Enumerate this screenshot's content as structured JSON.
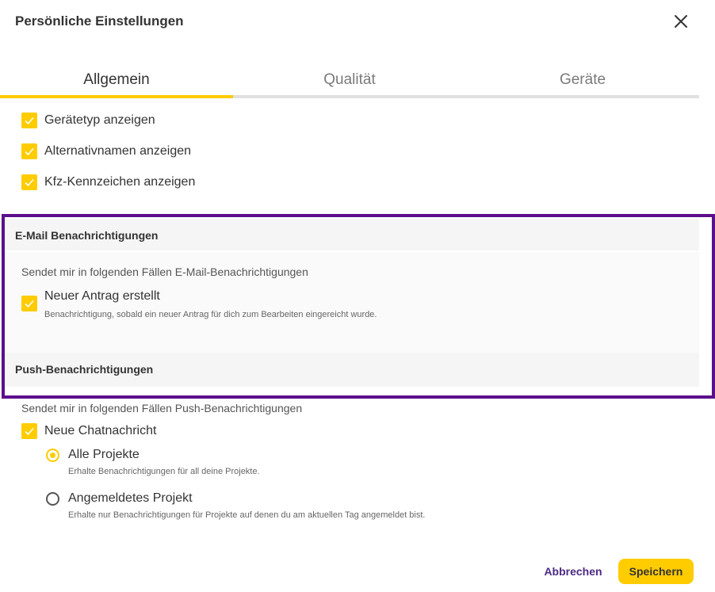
{
  "dialog": {
    "title": "Persönliche Einstellungen",
    "close_icon": "close-icon"
  },
  "tabs": [
    {
      "label": "Allgemein",
      "active": true
    },
    {
      "label": "Qualität",
      "active": false
    },
    {
      "label": "Geräte",
      "active": false
    }
  ],
  "general_options": [
    {
      "label": "Gerätetyp anzeigen",
      "checked": true
    },
    {
      "label": "Alternativnamen anzeigen",
      "checked": true
    },
    {
      "label": "Kfz-Kennzeichen anzeigen",
      "checked": true
    }
  ],
  "email_section": {
    "title": "E-Mail Benachrichtigungen",
    "hint": "Sendet mir in folgenden Fällen E-Mail-Benachrichtigungen",
    "options": [
      {
        "label": "Neuer Antrag erstellt",
        "description": "Benachrichtigung, sobald ein neuer Antrag für dich zum Bearbeiten eingereicht wurde.",
        "checked": true
      }
    ]
  },
  "push_section": {
    "title": "Push-Benachrichtigungen",
    "hint": "Sendet mir in folgenden Fällen Push-Benachrichtigungen",
    "options": [
      {
        "label": "Neue Chatnachricht",
        "checked": true
      }
    ],
    "radio_options": [
      {
        "label": "Alle Projekte",
        "description": "Erhalte Benachrichtigungen für all deine Projekte.",
        "selected": true
      },
      {
        "label": "Angemeldetes Projekt",
        "description": "Erhalte nur Benachrichtigungen für Projekte auf denen du am aktuellen Tag angemeldet bist.",
        "selected": false
      }
    ]
  },
  "footer": {
    "cancel_label": "Abbrechen",
    "save_label": "Speichern"
  },
  "colors": {
    "accent": "#ffcc00",
    "highlight_border": "#5c0f8b",
    "cancel_text": "#4b2a86"
  }
}
